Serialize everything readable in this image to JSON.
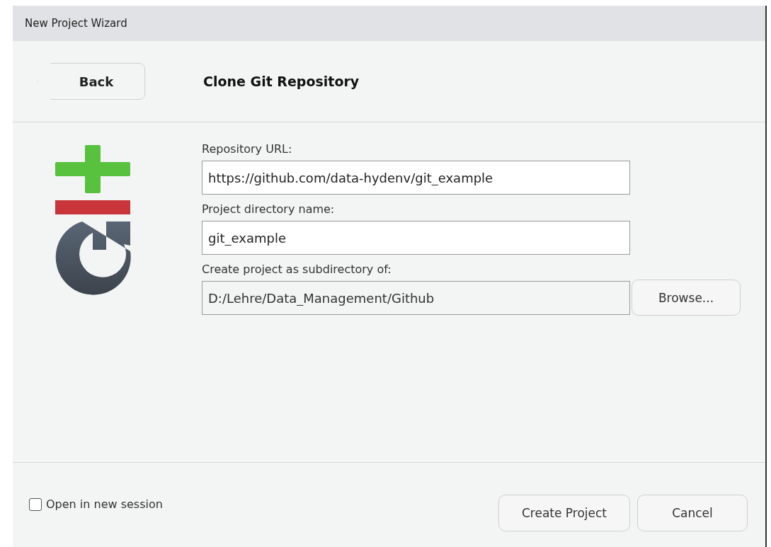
{
  "window": {
    "title": "New Project Wizard"
  },
  "back_button": {
    "label": "Back"
  },
  "page_title": "Clone Git Repository",
  "fields": [
    {
      "label": "Repository URL:",
      "value": "https://github.com/data-hydenv/git_example",
      "disabled": false
    },
    {
      "label": "Project directory name:",
      "value": "git_example",
      "disabled": false
    },
    {
      "label": "Create project as subdirectory of:",
      "value": "D:/Lehre/Data_Management/Github",
      "disabled": true,
      "button": "Browse..."
    }
  ],
  "open_in_new_session": {
    "label": "Open in new session",
    "checked": false
  },
  "buttons": [
    "Create Project",
    "Cancel"
  ]
}
